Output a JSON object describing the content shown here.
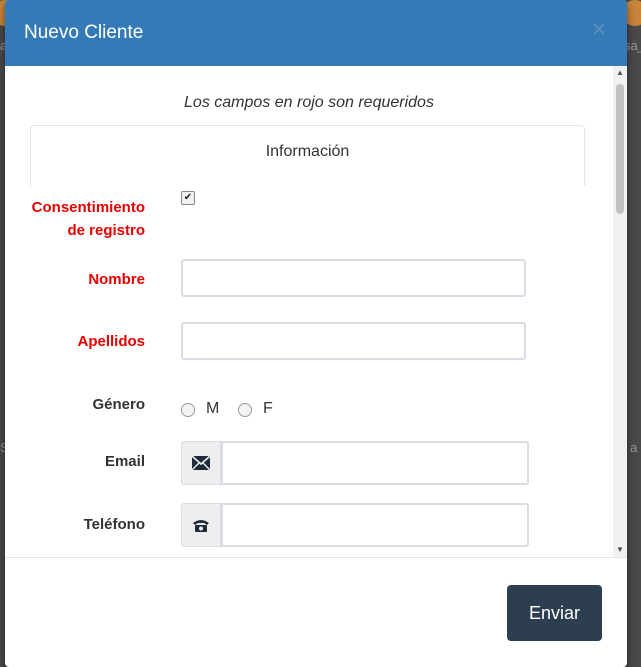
{
  "modal": {
    "title": "Nuevo Cliente",
    "close_symbol": "×",
    "required_note": "Los campos en rojo son requeridos",
    "tab_label": "Información"
  },
  "background": {
    "left_text": "a",
    "right_text": "sa_",
    "side_left": "S",
    "side_right": "a"
  },
  "form": {
    "consent": {
      "label_line1": "Consentimiento",
      "label_line2": "de registro",
      "checked": true,
      "check_mark": "✔"
    },
    "nombre": {
      "label": "Nombre",
      "value": ""
    },
    "apellidos": {
      "label": "Apellidos",
      "value": ""
    },
    "genero": {
      "label": "Género",
      "option_m": "M",
      "option_f": "F"
    },
    "email": {
      "label": "Email",
      "value": "",
      "icon": "envelope-icon"
    },
    "telefono": {
      "label": "Teléfono",
      "value": "",
      "icon": "phone-icon"
    }
  },
  "footer": {
    "submit_label": "Enviar"
  },
  "colors": {
    "header": "#337ab7",
    "required": "#e60000",
    "submit_bg": "#2c3e50"
  }
}
